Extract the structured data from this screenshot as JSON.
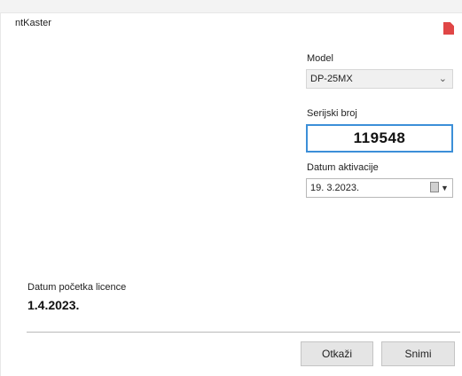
{
  "window": {
    "title": "ntKaster"
  },
  "form": {
    "model": {
      "label": "Model",
      "value": "DP-25MX"
    },
    "serial": {
      "label": "Serijski broj",
      "value": "119548"
    },
    "activation_date": {
      "label": "Datum aktivacije",
      "value": "19. 3.2023."
    }
  },
  "license": {
    "label": "Datum početka licence",
    "value": "1.4.2023."
  },
  "buttons": {
    "cancel": "Otkaži",
    "save": "Snimi"
  },
  "colors": {
    "accent_focus": "#3c8fd8",
    "close_icon": "#e04646"
  },
  "icons": {
    "close": "close-icon",
    "dropdown": "chevron-down-icon",
    "calendar": "calendar-icon"
  }
}
